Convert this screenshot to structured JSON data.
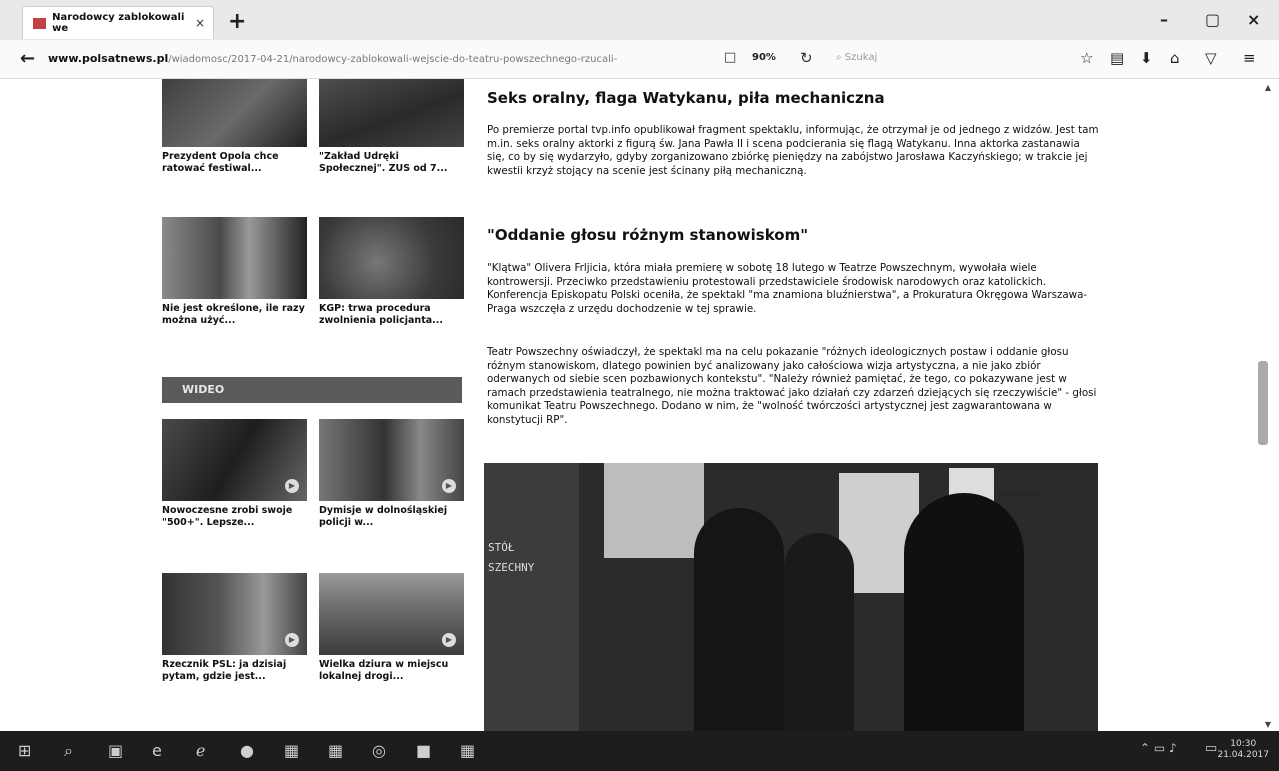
{
  "browser": {
    "tab_title": "Narodowcy zablokowali we",
    "tab_close": "×",
    "new_tab": "+",
    "window_controls": [
      "–",
      "▢",
      "×"
    ],
    "url_host": "www.polsatnews.pl",
    "url_path": "/wiadomosc/2017-04-21/narodowcy-zablokowali-wejscie-do-teatru-powszechnego-rzucali-",
    "zoom": "90%",
    "search_placeholder": "Szukaj"
  },
  "sidebar": {
    "cards": [
      {
        "meta": "",
        "title": "Prezydent Opola chce ratować festiwal..."
      },
      {
        "meta": "",
        "title": "\"Zakład Udręki Społecznej\". ZUS od 7..."
      },
      {
        "meta": "",
        "title": "Nie jest określone, ile razy można użyć..."
      },
      {
        "meta": "",
        "title": "KGP: trwa procedura zwolnienia policjanta..."
      }
    ],
    "section_label": "WIDEO",
    "video_cards": [
      {
        "meta": "",
        "title": "Nowoczesne zrobi swoje \"500+\". Lepsze..."
      },
      {
        "meta": "",
        "title": "Dymisje w dolnośląskiej policji w..."
      },
      {
        "meta": "",
        "title": "Rzecznik PSL: ja dzisiaj pytam, gdzie jest..."
      },
      {
        "meta": "",
        "title": "Wielka dziura w miejscu lokalnej drogi..."
      }
    ]
  },
  "article": {
    "h_section1": "Seks oralny, flaga Watykanu, piła mechaniczna",
    "p1": "Po premierze portal tvp.info opublikował fragment spektaklu, informując, że otrzymał je od jednego z widzów. Jest tam m.in. seks oralny aktorki z figurą św. Jana Pawła II i scena podcierania się flagą Watykanu. Inna aktorka zastanawia się, co by się wydarzyło, gdyby zorganizowano zbiórkę pieniędzy na zabójstwo Jarosława Kaczyńskiego; w trakcie jej kwestii krzyż stojący na scenie jest ścinany piłą mechaniczną.",
    "h_section2": "\"Oddanie głosu różnym stanowiskom\"",
    "p2": "\"Klątwa\" Olivera Frljicia, która miała premierę w sobotę 18 lutego w Teatrze Powszechnym, wywołała wiele kontrowersji. Przeciwko przedstawieniu protestowali przedstawiciele środowisk narodowych oraz katolickich. Konferencja Episkopatu Polski oceniła, że spektakl \"ma znamiona bluźnierstwa\", a Prokuratura Okręgowa Warszawa-Praga wszczęła z urzędu dochodzenie w tej sprawie.",
    "p3": "Teatr Powszechny oświadczył, że spektakl ma na celu pokazanie \"różnych ideologicznych postaw i oddanie głosu różnym stanowiskom, dlatego powinien być analizowany jako całościowa wizja artystyczna, a nie jako zbiór oderwanych od siebie scen pozbawionych kontekstu\". \"Należy również pamiętać, że tego, co pokazywane jest w ramach przedstawienia teatralnego, nie można traktować jako działań czy zdarzeń dziejących się rzeczywiście\" - głosi komunikat Teatru Powszechnego. Dodano w nim, że \"wolność twórczości artystycznej jest zagwarantowana w konstytucji RP\".",
    "photo_sign_1": "STÓŁ",
    "photo_sign_2": "SZECHNY",
    "photo_sign_3": "POWSZECHNY"
  },
  "taskbar": {
    "time": "10:30",
    "date": "21.04.2017"
  }
}
